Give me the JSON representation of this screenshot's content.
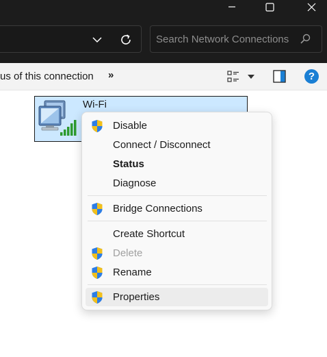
{
  "window": {
    "minimize_icon": "minimize-icon",
    "maximize_icon": "maximize-icon",
    "close_icon": "close-icon"
  },
  "address": {
    "search_placeholder": "Search Network Connections"
  },
  "commandbar": {
    "partial_command": "us of this connection",
    "more": "»",
    "help": "?"
  },
  "connection": {
    "name": "Wi-Fi"
  },
  "context_menu": {
    "items": [
      {
        "label": "Disable",
        "shield": true,
        "bold": false,
        "disabled": false
      },
      {
        "label": "Connect / Disconnect",
        "shield": false,
        "bold": false,
        "disabled": false
      },
      {
        "label": "Status",
        "shield": false,
        "bold": true,
        "disabled": false
      },
      {
        "label": "Diagnose",
        "shield": false,
        "bold": false,
        "disabled": false
      },
      {
        "label": "Bridge Connections",
        "shield": true,
        "bold": false,
        "disabled": false
      },
      {
        "label": "Create Shortcut",
        "shield": false,
        "bold": false,
        "disabled": false
      },
      {
        "label": "Delete",
        "shield": true,
        "bold": false,
        "disabled": true
      },
      {
        "label": "Rename",
        "shield": true,
        "bold": false,
        "disabled": false
      },
      {
        "label": "Properties",
        "shield": true,
        "bold": false,
        "disabled": false,
        "highlighted": true
      }
    ]
  },
  "colors": {
    "titlebar": "#1c1c1c",
    "selection": "#cce8ff",
    "accent": "#1a7fd4"
  }
}
